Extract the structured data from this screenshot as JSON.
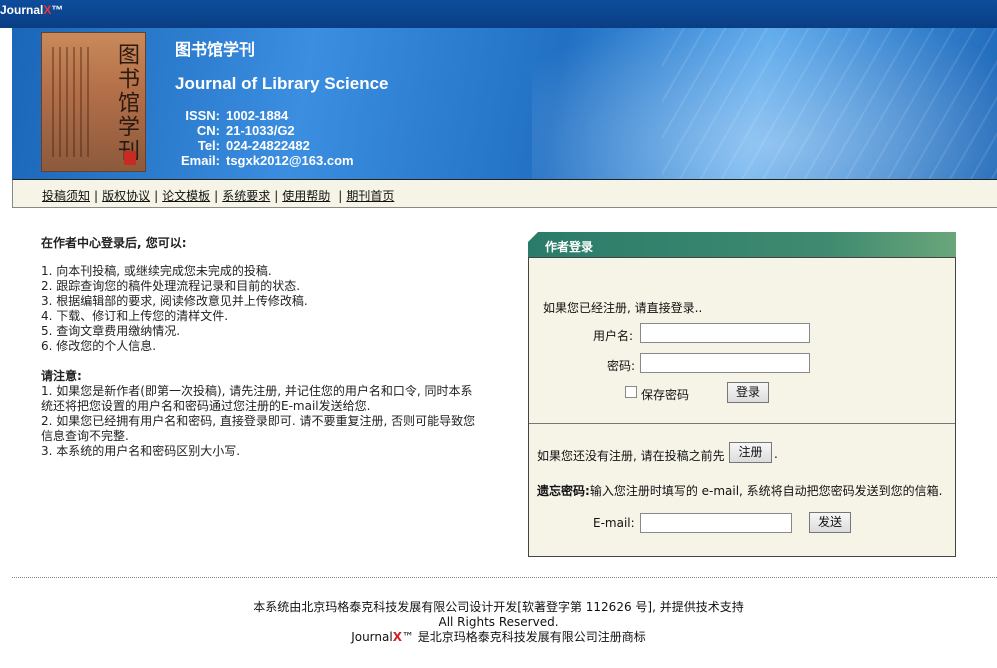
{
  "brand": {
    "name": "Journal",
    "x": "X",
    "tm": "™"
  },
  "journal": {
    "title_cn": "图书馆学刊",
    "title_en": "Journal of Library Science",
    "cover_text": "图书馆学刊",
    "issn_label": "ISSN:",
    "issn": "1002-1884",
    "cn_label": "CN:",
    "cn": "21-1033/G2",
    "tel_label": "Tel:",
    "tel": "024-24822482",
    "email_label": "Email:",
    "email": "tsgxk2012@163.com"
  },
  "nav": [
    {
      "label": "投稿须知"
    },
    {
      "label": "版权协议"
    },
    {
      "label": "论文模板"
    },
    {
      "label": "系统要求"
    },
    {
      "label": "使用帮助"
    },
    {
      "label": "期刊首页"
    }
  ],
  "nav_separator": "|",
  "intro": {
    "heading": "在作者中心登录后, 您可以:",
    "items": [
      "1. 向本刊投稿, 或继续完成您未完成的投稿.",
      "2. 跟踪查询您的稿件处理流程记录和目前的状态.",
      "3. 根据编辑部的要求, 阅读修改意见并上传修改稿.",
      "4. 下载、修订和上传您的清样文件.",
      "5. 查询文章费用缴纳情况.",
      "6. 修改您的个人信息."
    ],
    "note_title": "请注意:",
    "notes": [
      "1. 如果您是新作者(即第一次投稿), 请先注册, 并记住您的用户名和口令, 同时本系统还将把您设置的用户名和密码通过您注册的E-mail发送给您.",
      "2. 如果您已经拥有用户名和密码, 直接登录即可. 请不要重复注册, 否则可能导致您信息查询不完整.",
      "3. 本系统的用户名和密码区别大小写."
    ]
  },
  "login": {
    "panel_title": "作者登录",
    "prompt": "如果您已经注册, 请直接登录..",
    "username_label": "用户名:",
    "username_value": "",
    "password_label": "密码:",
    "password_value": "",
    "remember_label": "保存密码",
    "remember_checked": false,
    "login_button": "登录",
    "register_prompt": "如果您还没有注册, 请在投稿之前先",
    "register_button": "注册",
    "register_suffix": ".",
    "forgot_title": "遗忘密码:",
    "forgot_text": "输入您注册时填写的 e-mail, 系统将自动把您密码发送到您的信箱.",
    "email_label": "E-mail:",
    "email_value": "",
    "send_button": "发送"
  },
  "footer": {
    "line1": "本系统由北京玛格泰克科技发展有限公司设计开发[软著登字第 112626 号], 并提供技术支持",
    "line2": "All Rights Reserved.",
    "trademark_name": "Journal",
    "trademark_x": "X",
    "trademark_tm": "™",
    "trademark_text": " 是北京玛格泰克科技发展有限公司注册商标"
  },
  "colors": {
    "header_blue": "#0d4d9c",
    "panel_head_green": "#2a7c6a",
    "panel_bg": "#f6f4e7",
    "brand_red": "#e33333"
  }
}
